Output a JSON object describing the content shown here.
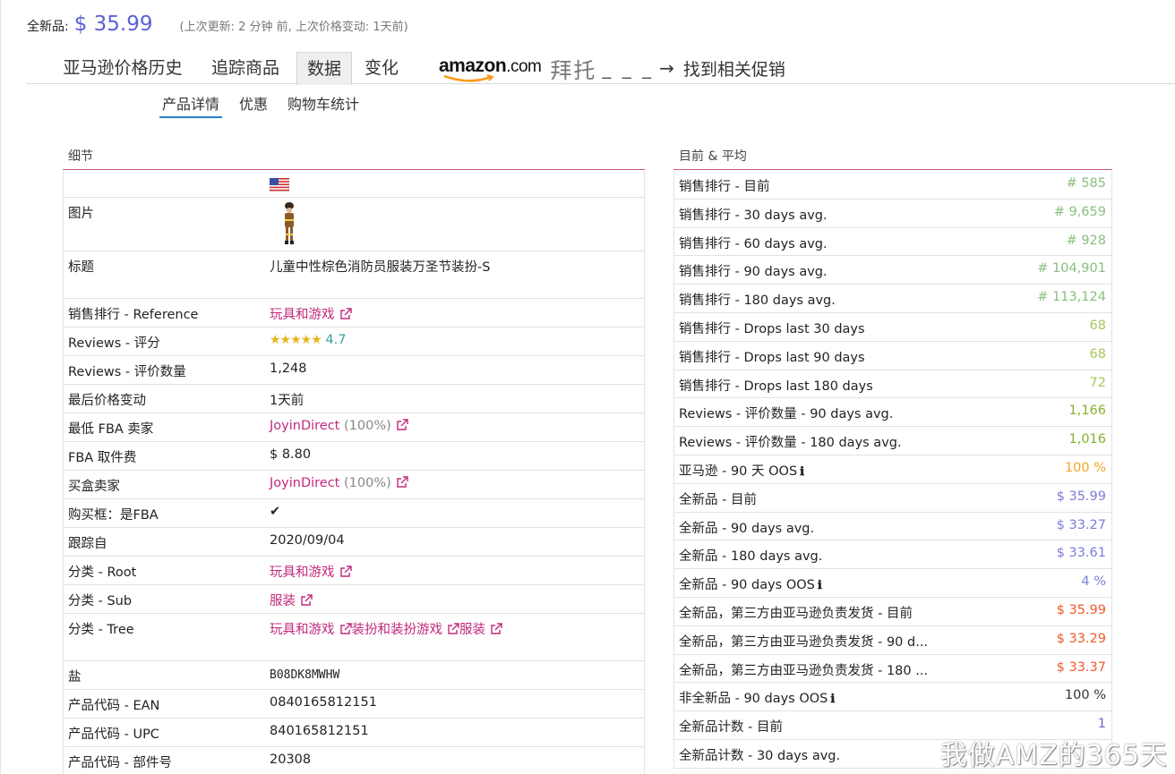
{
  "header": {
    "price_label": "全新品:",
    "price_value": "$ 35.99",
    "update_info": "(上次更新:  2 分钟 前, 上次价格变动: 1天前)"
  },
  "tabs": [
    {
      "label": "亚马逊价格历史"
    },
    {
      "label": "追踪商品"
    },
    {
      "label": "数据"
    },
    {
      "label": "变化"
    }
  ],
  "brand": {
    "logo_text": "amazon",
    "logo_suffix": ".com",
    "word": "拜托",
    "blank": "_ _ _",
    "arrow": "→",
    "link": "找到相关促销"
  },
  "subtabs": [
    {
      "label": "产品详情"
    },
    {
      "label": "优惠"
    },
    {
      "label": "购物车统计"
    }
  ],
  "details": {
    "heading": "细节",
    "rows": {
      "image_label": "图片",
      "title_label": "标题",
      "title_value": "儿童中性棕色消防员服装万圣节装扮-S",
      "rank_ref_label": "销售排行 - Reference",
      "rank_ref_value": "玩具和游戏",
      "rating_label": "Reviews - 评分",
      "rating_stars": "★★★★★",
      "rating_value": "4.7",
      "count_label": "Reviews - 评价数量",
      "count_value": "1,248",
      "last_change_label": "最后价格变动",
      "last_change_value": "1天前",
      "low_fba_label": "最低 FBA 卖家",
      "low_fba_seller": "JoyinDirect",
      "low_fba_pct": "(100%)",
      "fba_fee_label": "FBA 取件费",
      "fba_fee_value": "$ 8.80",
      "buybox_label": "买盒卖家",
      "buybox_seller": "JoyinDirect",
      "buybox_pct": "(100%)",
      "buybox_fba_label": "购买框：是FBA",
      "buybox_fba_value": "✔",
      "tracked_label": "跟踪自",
      "tracked_value": "2020/09/04",
      "cat_root_label": "分类 - Root",
      "cat_root_value": "玩具和游戏",
      "cat_sub_label": "分类 - Sub",
      "cat_sub_value": "服装",
      "cat_tree_label": "分类 - Tree",
      "cat_tree_1": "玩具和游戏",
      "cat_tree_2": "装扮和装扮游戏",
      "cat_tree_3": "服装",
      "asin_label": "盐",
      "asin_value": "B08DK8MWHW",
      "ean_label": "产品代码 - EAN",
      "ean_value": "0840165812151",
      "upc_label": "产品代码 - UPC",
      "upc_value": "840165812151",
      "part_label": "产品代码 - 部件号",
      "part_value": "20308"
    }
  },
  "averages": {
    "heading": "目前 & 平均",
    "rows": [
      {
        "label": "销售排行 - 目前",
        "value": "# 585",
        "color": "#8bbf7e"
      },
      {
        "label": "销售排行 - 30 days avg.",
        "value": "# 9,659",
        "color": "#8bbf7e"
      },
      {
        "label": "销售排行 - 60 days avg.",
        "value": "# 928",
        "color": "#8bbf7e"
      },
      {
        "label": "销售排行 - 90 days avg.",
        "value": "# 104,901",
        "color": "#8bbf7e"
      },
      {
        "label": "销售排行 - 180 days avg.",
        "value": "# 113,124",
        "color": "#8bbf7e"
      },
      {
        "label": "销售排行 - Drops last 30 days",
        "value": "68",
        "color": "#a6c75d"
      },
      {
        "label": "销售排行 - Drops last 90 days",
        "value": "68",
        "color": "#a6c75d"
      },
      {
        "label": "销售排行 - Drops last 180 days",
        "value": "72",
        "color": "#a6c75d"
      },
      {
        "label": "Reviews - 评价数量 - 90 days avg.",
        "value": "1,166",
        "color": "#86b12a"
      },
      {
        "label": "Reviews - 评价数量 - 180 days avg.",
        "value": "1,016",
        "color": "#86b12a"
      },
      {
        "label": "亚马逊 - 90 天 OOS",
        "value": "100 %",
        "color": "#f5a623",
        "info": "ℹ"
      },
      {
        "label": "全新品 - 目前",
        "value": "$ 35.99",
        "color": "#7c7cd8"
      },
      {
        "label": "全新品 - 90 days avg.",
        "value": "$ 33.27",
        "color": "#7c7cd8"
      },
      {
        "label": "全新品 - 180 days avg.",
        "value": "$ 33.61",
        "color": "#7c7cd8"
      },
      {
        "label": "全新品 - 90 days OOS",
        "value": "4 %",
        "color": "#7c7cd8",
        "info": "ℹ"
      },
      {
        "label": "全新品，第三方由亚马逊负责发货 - 目前",
        "value": "$ 35.99",
        "color": "#f05a2a"
      },
      {
        "label": "全新品，第三方由亚马逊负责发货 - 90 d...",
        "value": "$ 33.29",
        "color": "#f05a2a"
      },
      {
        "label": "全新品，第三方由亚马逊负责发货 - 180 ...",
        "value": "$ 33.37",
        "color": "#f05a2a"
      },
      {
        "label": "非全新品 - 90 days OOS",
        "value": "100 %",
        "color": "#333333",
        "info": "ℹ"
      },
      {
        "label": "全新品计数 - 目前",
        "value": "1",
        "color": "#6a6ad0"
      },
      {
        "label": "全新品计数 - 30 days avg.",
        "value": "",
        "color": "#6a6ad0"
      }
    ]
  },
  "watermark": "我做AMZ的365天"
}
